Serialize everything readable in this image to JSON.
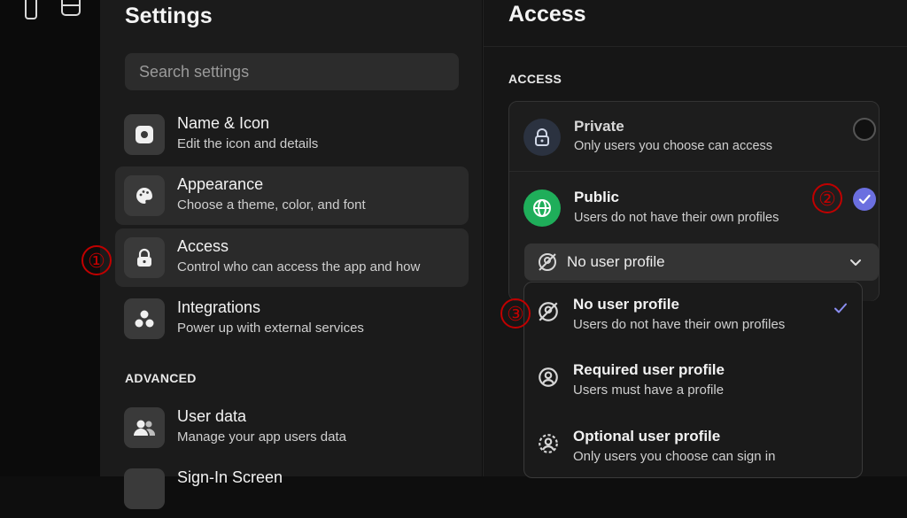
{
  "settings": {
    "title": "Settings",
    "search_placeholder": "Search settings",
    "items": [
      {
        "label": "Name & Icon",
        "sub": "Edit the icon and details",
        "icon": "app-icon"
      },
      {
        "label": "Appearance",
        "sub": "Choose a theme, color, and font",
        "icon": "palette-icon"
      },
      {
        "label": "Access",
        "sub": "Control who can access the app and how",
        "icon": "lock-icon"
      },
      {
        "label": "Integrations",
        "sub": "Power up with external services",
        "icon": "integrations-icon"
      }
    ],
    "advanced_label": "ADVANCED",
    "advanced_items": [
      {
        "label": "User data",
        "sub": "Manage your app users data",
        "icon": "users-icon"
      },
      {
        "label": "Sign-In Screen",
        "icon": "sign-in-icon"
      }
    ]
  },
  "access": {
    "title": "Access",
    "section_label": "ACCESS",
    "private": {
      "title": "Private",
      "sub": "Only users you choose can access"
    },
    "public": {
      "title": "Public",
      "sub": "Users do not have their own profiles"
    },
    "select_value": "No user profile",
    "dropdown": [
      {
        "title": "No user profile",
        "sub": "Users do not have their own profiles",
        "checked": true
      },
      {
        "title": "Required user profile",
        "sub": "Users must have a profile"
      },
      {
        "title": "Optional user profile",
        "sub": "Only users you choose can sign in"
      }
    ]
  },
  "annotations": [
    "①",
    "②",
    "③"
  ],
  "colors": {
    "accent": "#6b6fe0",
    "public_icon": "#1fae5a",
    "marker": "#c00000"
  }
}
